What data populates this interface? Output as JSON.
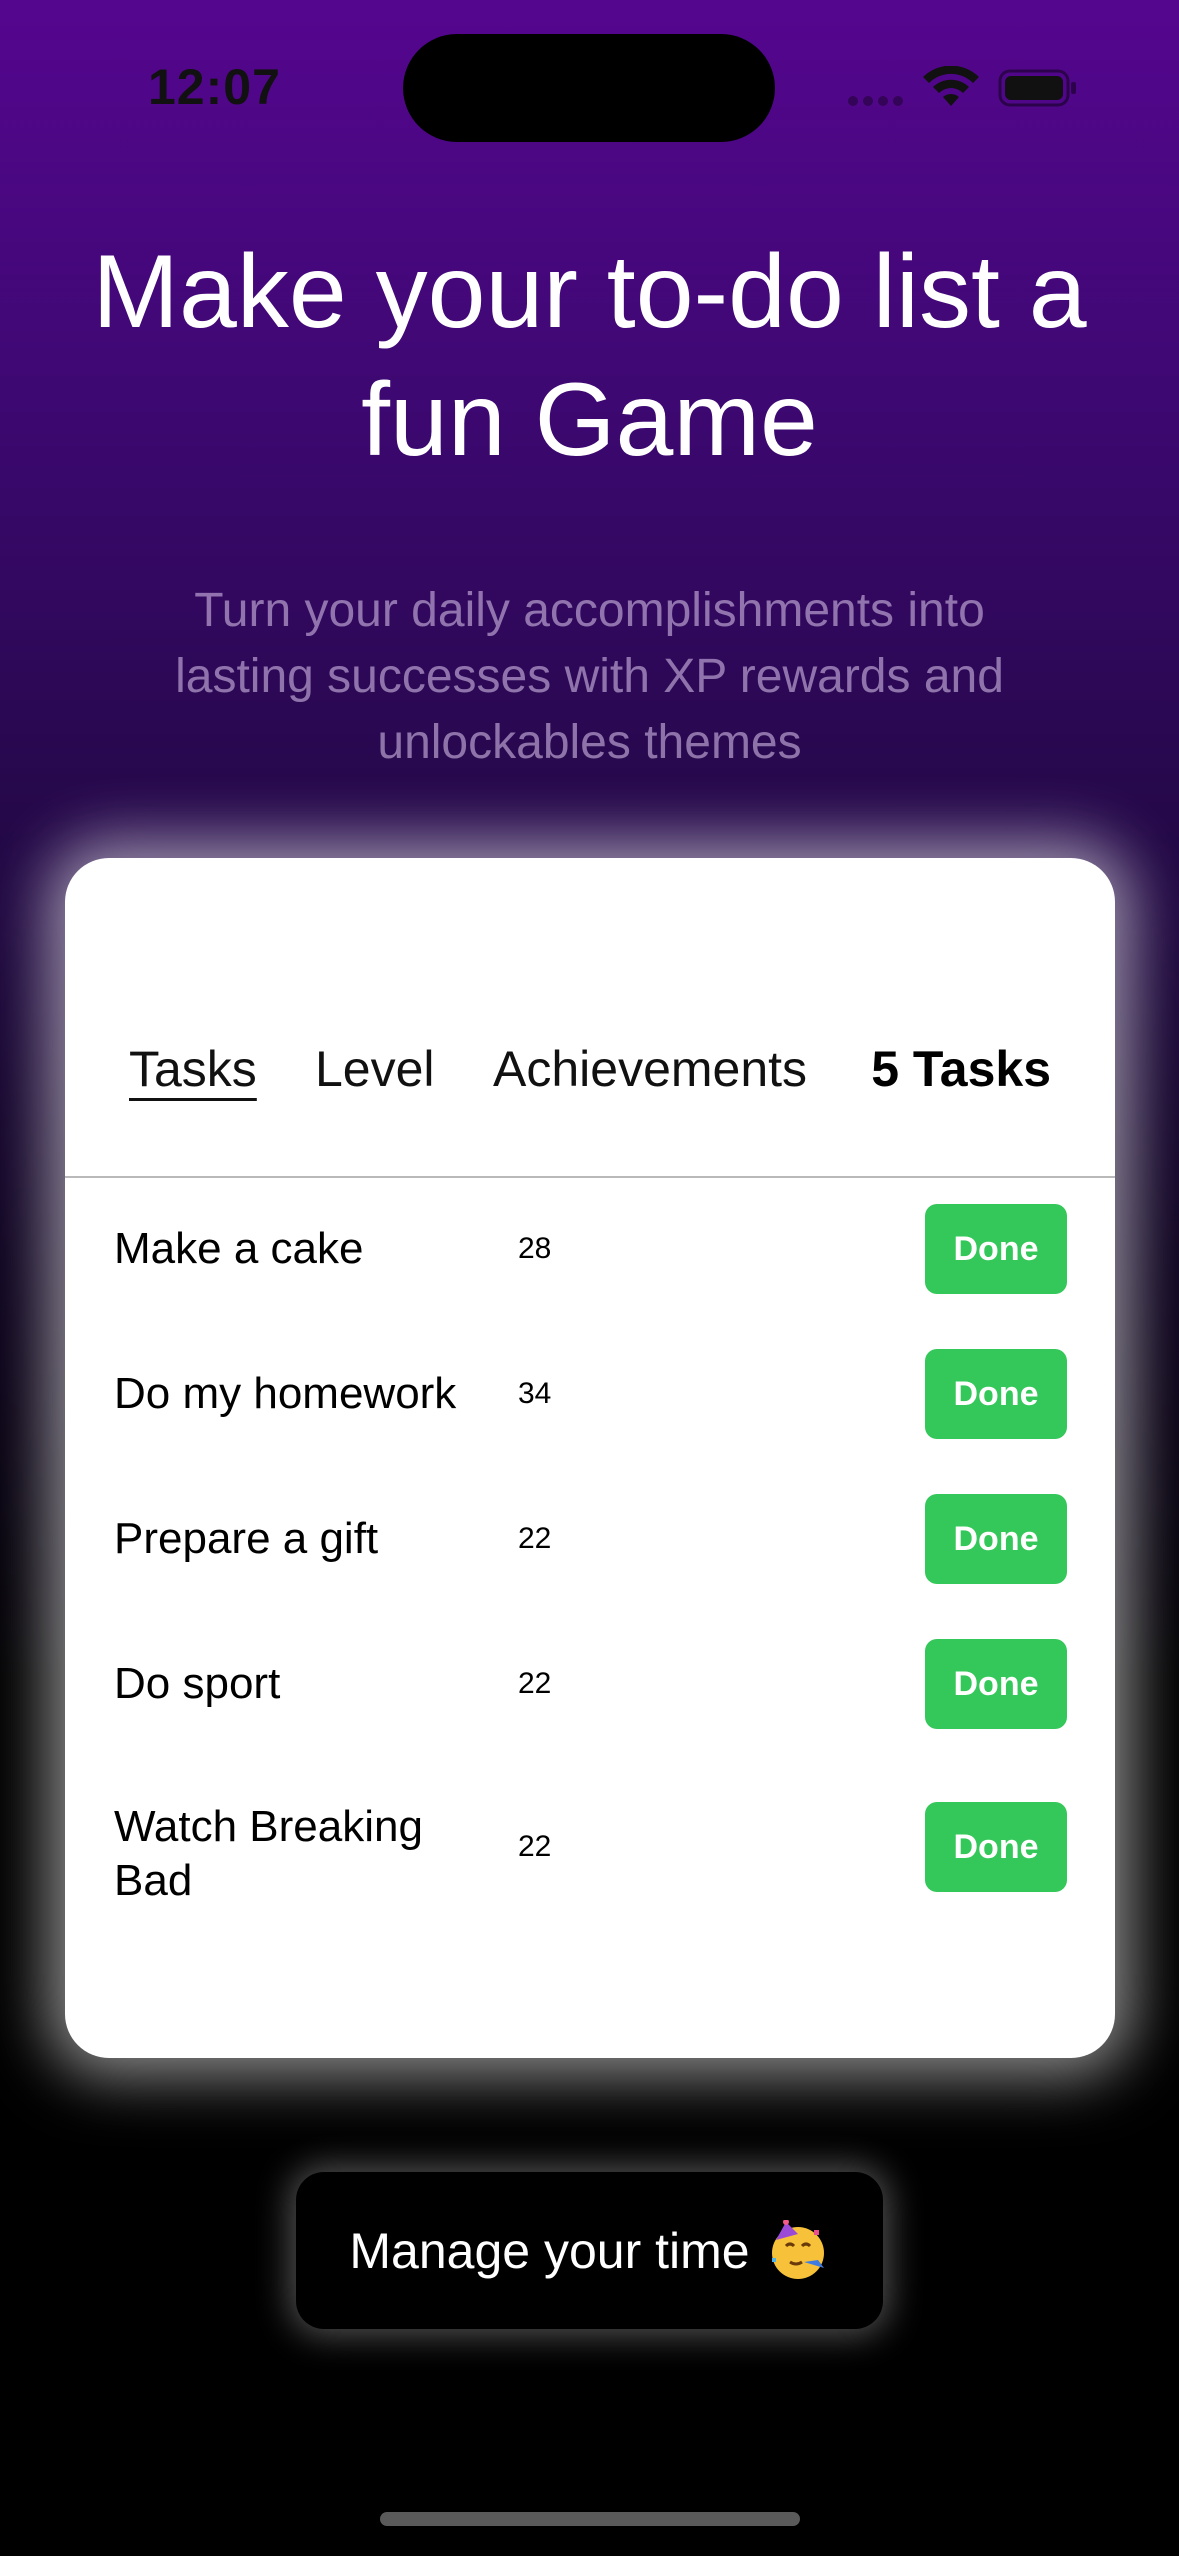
{
  "status_bar": {
    "time": "12:07"
  },
  "hero": {
    "title_line1": "Make your to-do list a",
    "title_line2": "fun Game",
    "subtitle_line1": "Turn your daily accomplishments into",
    "subtitle_line2": "lasting successes with XP rewards and",
    "subtitle_line3": "unlockables themes"
  },
  "card": {
    "tabs": [
      {
        "label": "Tasks",
        "active": true
      },
      {
        "label": "Level",
        "active": false
      },
      {
        "label": "Achievements",
        "active": false
      }
    ],
    "task_count": "5 Tasks",
    "tasks": [
      {
        "name": "Make a cake",
        "xp": "28",
        "action": "Done"
      },
      {
        "name": "Do my homework",
        "xp": "34",
        "action": "Done"
      },
      {
        "name": "Prepare a gift",
        "xp": "22",
        "action": "Done"
      },
      {
        "name": "Do sport",
        "xp": "22",
        "action": "Done"
      },
      {
        "name": "Watch Breaking Bad",
        "xp": "22",
        "action": "Done"
      }
    ]
  },
  "cta": {
    "label": "Manage your time",
    "icon": "partying-face-emoji"
  },
  "colors": {
    "accent_green": "#34c759",
    "gradient_top": "#55068f",
    "background_bottom": "#000000"
  }
}
